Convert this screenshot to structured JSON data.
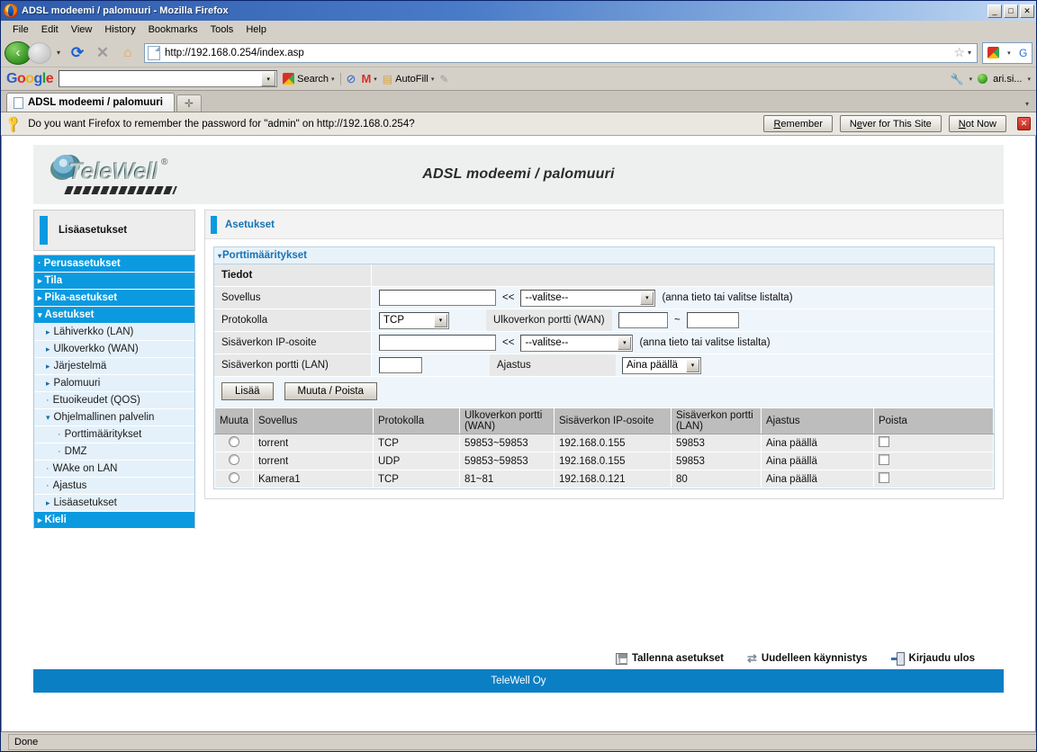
{
  "window": {
    "title": "ADSL modeemi / palomuuri - Mozilla Firefox",
    "minimize": "_",
    "maximize": "□",
    "close": "✕"
  },
  "menubar": [
    "File",
    "Edit",
    "View",
    "History",
    "Bookmarks",
    "Tools",
    "Help"
  ],
  "navbar": {
    "back_icon": "‹",
    "forward_icon": "›",
    "dropdown_icon": "▾",
    "reload_icon": "⟳",
    "stop_icon": "✕",
    "home_icon": "⌂",
    "url": "http://192.168.0.254/index.asp",
    "star_icon": "☆",
    "caret_icon": "▾",
    "search_g": "G",
    "magnifier_icon": "🔍"
  },
  "google_toolbar": {
    "logo": [
      "G",
      "o",
      "o",
      "g",
      "l",
      "e"
    ],
    "search_value": "",
    "search_label": "Search",
    "autofill_label": "AutoFill",
    "account_label": "ari.si...",
    "caret": "▾"
  },
  "tabs": {
    "active_label": "ADSL modeemi / palomuuri",
    "new_tab_icon": "✛",
    "list_caret": "▾"
  },
  "notification": {
    "text": "Do you want Firefox to remember the password for \"admin\" on http://192.168.0.254?",
    "remember": "Remember",
    "never": "Never for This Site",
    "not_now": "Not Now",
    "close_icon": "✕"
  },
  "banner": {
    "brand": "TeleWell",
    "registered": "®",
    "title": "ADSL modeemi / palomuuri"
  },
  "sidebar": {
    "header": "Lisäasetukset",
    "items": [
      {
        "label": "Perusasetukset",
        "level": 0,
        "marker": "·"
      },
      {
        "label": "Tila",
        "level": 0,
        "marker": "▸"
      },
      {
        "label": "Pika-asetukset",
        "level": 0,
        "marker": "▸"
      },
      {
        "label": "Asetukset",
        "level": 0,
        "marker": "▾"
      },
      {
        "label": "Lähiverkko (LAN)",
        "level": 1,
        "marker": "▸"
      },
      {
        "label": "Ulkoverkko (WAN)",
        "level": 1,
        "marker": "▸"
      },
      {
        "label": "Järjestelmä",
        "level": 1,
        "marker": "▸"
      },
      {
        "label": "Palomuuri",
        "level": 1,
        "marker": "▸"
      },
      {
        "label": "Etuoikeudet (QOS)",
        "level": 1,
        "marker": "·"
      },
      {
        "label": "Ohjelmallinen palvelin",
        "level": 1,
        "marker": "▾"
      },
      {
        "label": "Porttimääritykset",
        "level": 2,
        "marker": "·"
      },
      {
        "label": "DMZ",
        "level": 2,
        "marker": "·"
      },
      {
        "label": "WAke on LAN",
        "level": 1,
        "marker": "·"
      },
      {
        "label": "Ajastus",
        "level": 1,
        "marker": "·"
      },
      {
        "label": "Lisäasetukset",
        "level": 1,
        "marker": "▸"
      },
      {
        "label": "Kieli",
        "level": 0,
        "marker": "▸"
      }
    ]
  },
  "main": {
    "header": "Asetukset",
    "panel_title": "Porttimääritykset",
    "panel_triangle": "▾",
    "section_label": "Tiedot",
    "form": {
      "sovellus_label": "Sovellus",
      "sovellus_value": "",
      "sovellus_arrows": "<<",
      "sovellus_select": "--valitse--",
      "sovellus_hint": "(anna tieto tai valitse listalta)",
      "protokolla_label": "Protokolla",
      "protokolla_select": "TCP",
      "wan_port_label": "Ulkoverkon portti (WAN)",
      "wan_port_from": "",
      "wan_port_sep": "~",
      "wan_port_to": "",
      "lan_ip_label": "Sisäverkon IP-osoite",
      "lan_ip_value": "",
      "lan_ip_arrows": "<<",
      "lan_ip_select": "--valitse--",
      "lan_ip_hint": "(anna tieto tai valitse listalta)",
      "lan_port_label": "Sisäverkon portti (LAN)",
      "lan_port_value": "",
      "ajastus_label": "Ajastus",
      "ajastus_select": "Aina päällä",
      "select_arrow": "▾"
    },
    "buttons": {
      "add": "Lisää",
      "edit_delete": "Muuta / Poista"
    },
    "table": {
      "columns": [
        "Muuta",
        "Sovellus",
        "Protokolla",
        "Ulkoverkon portti (WAN)",
        "Sisäverkon IP-osoite",
        "Sisäverkon portti (LAN)",
        "Ajastus",
        "Poista"
      ],
      "rows": [
        {
          "sovellus": "torrent",
          "protokolla": "TCP",
          "wan_port": "59853~59853",
          "lan_ip": "192.168.0.155",
          "lan_port": "59853",
          "ajastus": "Aina päällä"
        },
        {
          "sovellus": "torrent",
          "protokolla": "UDP",
          "wan_port": "59853~59853",
          "lan_ip": "192.168.0.155",
          "lan_port": "59853",
          "ajastus": "Aina päällä"
        },
        {
          "sovellus": "Kamera1",
          "protokolla": "TCP",
          "wan_port": "81~81",
          "lan_ip": "192.168.0.121",
          "lan_port": "80",
          "ajastus": "Aina päällä"
        }
      ]
    },
    "footer_links": [
      {
        "label": "Tallenna asetukset"
      },
      {
        "label": "Uudelleen käynnistys"
      },
      {
        "label": "Kirjaudu ulos"
      }
    ],
    "page_footer": "TeleWell Oy"
  },
  "statusbar": {
    "text": "Done"
  },
  "colors": {
    "accent_blue": "#0b9ae0",
    "footer_blue": "#0b7fc4",
    "link_blue": "#1873b4",
    "panel_bg": "#eef5fb",
    "label_bg": "#e8e8e8"
  }
}
